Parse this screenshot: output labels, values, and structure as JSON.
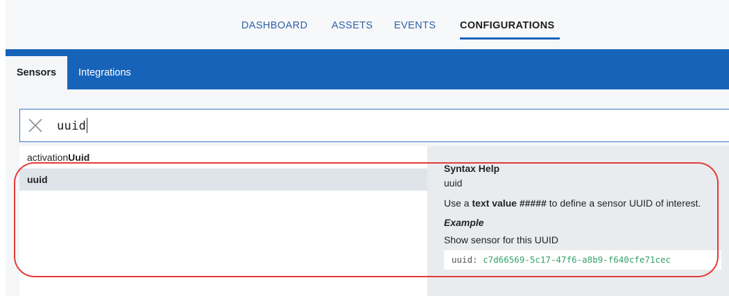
{
  "nav": {
    "items": [
      {
        "label": "DASHBOARD"
      },
      {
        "label": "ASSETS"
      },
      {
        "label": "EVENTS"
      },
      {
        "label": "CONFIGURATIONS"
      }
    ]
  },
  "tabs": [
    {
      "label": "Sensors"
    },
    {
      "label": "Integrations"
    }
  ],
  "search": {
    "value": "uuid"
  },
  "suggestions": [
    {
      "prefix": "activation",
      "match": "Uuid"
    },
    {
      "prefix": "",
      "match": "uuid"
    }
  ],
  "help": {
    "title": "Syntax Help",
    "keyword": "uuid",
    "desc_pre": "Use a ",
    "desc_bold": "text value #####",
    "desc_post": " to define a sensor UUID of interest.",
    "example_heading": "Example",
    "example_desc": "Show sensor for this UUID",
    "code_key": "uuid: ",
    "code_value": "c7d66569-5c17-47f6-a8b9-f640cfe71cec"
  },
  "colors": {
    "brand_blue": "#1763ba",
    "highlight_red": "#e43a35",
    "code_green": "#34a06a"
  },
  "icons": {
    "clear": "close-icon"
  }
}
